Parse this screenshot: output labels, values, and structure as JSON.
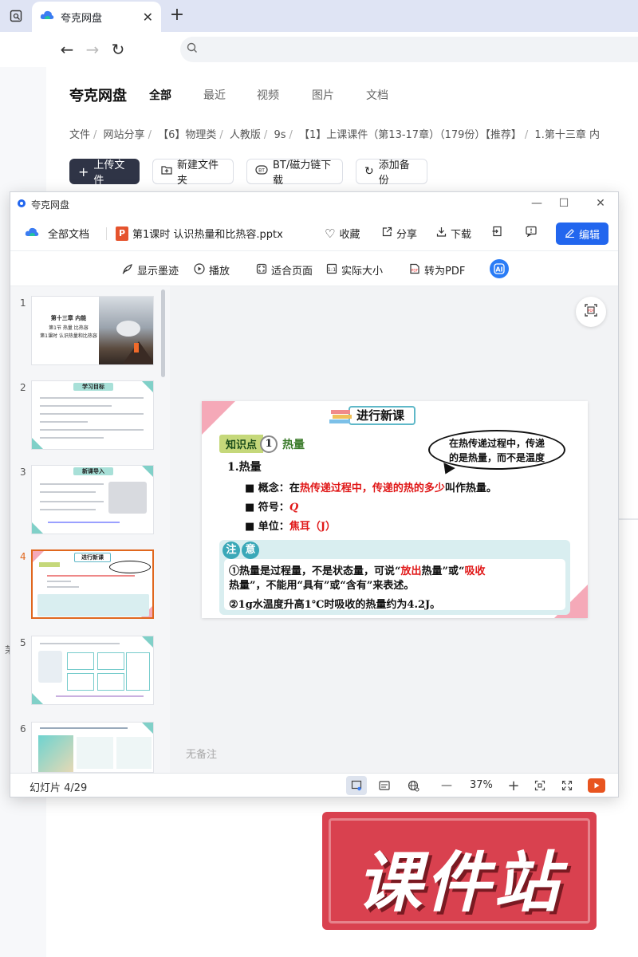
{
  "browser": {
    "tab_title": "夸克网盘",
    "tab_close": "✕",
    "new_tab": "+"
  },
  "drive": {
    "brand": "夸克网盘",
    "categories": [
      "全部",
      "最近",
      "视频",
      "图片",
      "文档"
    ],
    "breadcrumb": [
      "文件",
      "网站分享",
      "【6】物理类",
      "人教版",
      "9s",
      "【1】上课课件（第13-17章）（179份）【推荐】",
      "1.第十三章 内"
    ],
    "buttons": {
      "upload": "上传文件",
      "new_folder": "新建文件夹",
      "bt_download": "BT/磁力链下载",
      "add_backup": "添加备份"
    }
  },
  "viewer": {
    "window_title": "夸克网盘",
    "all_docs": "全部文档",
    "file_name": "第1课时 认识热量和比热容.pptx",
    "ppt_badge": "P",
    "actions": {
      "favorite": "收藏",
      "share": "分享",
      "download": "下载",
      "edit": "编辑"
    },
    "subtoolbar": {
      "show_ink": "显示墨迹",
      "play": "播放",
      "fit_page": "适合页面",
      "actual_size": "实际大小",
      "to_pdf": "转为PDF",
      "ai": "AI"
    },
    "thumbnails": [
      {
        "num": "1",
        "title": "第十三章 内能",
        "sub": "第1节 热量 比热容",
        "sub2": "第1课时 认识热量和比热容"
      },
      {
        "num": "2",
        "title": "学习目标"
      },
      {
        "num": "3",
        "title": "新课导入"
      },
      {
        "num": "4",
        "title": "进行新课"
      },
      {
        "num": "5",
        "title": ""
      },
      {
        "num": "6",
        "title": ""
      }
    ],
    "notes": "无备注",
    "status": {
      "slide_counter": "幻灯片 4/29",
      "zoom": "37%",
      "zoom_out": "—",
      "zoom_in": "+"
    },
    "slide": {
      "banner": "进行新课",
      "kp_tag": "知识点",
      "kp_num": "1",
      "kp_title": "热量",
      "heading": "1.热量",
      "bubble_l1": "在热传递过程中，传递",
      "bubble_l2": "的是热量，而不是温度",
      "li1_label": "■ 概念：",
      "li1_pre": "在",
      "li1_red": "热传递过程中，传递的热的多少",
      "li1_post": "叫作热量。",
      "li2_label": "■ 符号：",
      "li2_red": "Q",
      "li3_label": "■ 单位：",
      "li3_red": "焦耳",
      "li3_post": "（J）",
      "note_tag": [
        "注",
        "意"
      ],
      "note1_a": "①热量是过程量，不是状态量，可说“",
      "note1_red1": "放出",
      "note1_b": "热量”或“",
      "note1_red2": "吸收",
      "note1_c": "热量”，不能用“具有”或“含有”来表述。",
      "note2": "②1g水温度升高1℃时吸收的热量约为4.2J。"
    }
  },
  "watermark": "课件站",
  "left_char": "苿"
}
